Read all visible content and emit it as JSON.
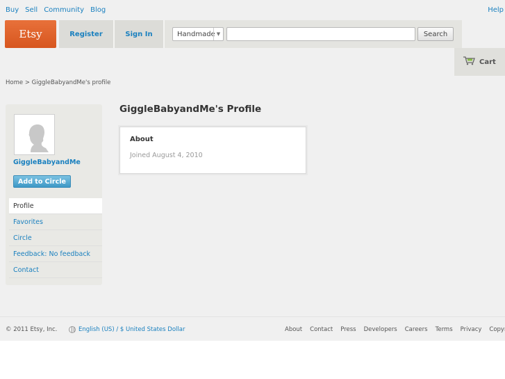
{
  "top_nav": {
    "items": [
      "Buy",
      "Sell",
      "Community",
      "Blog"
    ],
    "help": "Help"
  },
  "header": {
    "logo": "Etsy",
    "register": "Register",
    "sign_in": "Sign In",
    "category_selected": "Handmade",
    "search_value": "",
    "search_button": "Search",
    "cart": "Cart"
  },
  "breadcrumb": {
    "home": "Home",
    "separator": ">",
    "current": "GiggleBabyandMe's profile"
  },
  "sidebar": {
    "username": "GiggleBabyandMe",
    "add_button": "Add to Circle",
    "items": [
      {
        "label": "Profile",
        "active": true
      },
      {
        "label": "Favorites",
        "active": false
      },
      {
        "label": "Circle",
        "active": false
      },
      {
        "label": "Feedback: No feedback",
        "active": false
      },
      {
        "label": "Contact",
        "active": false
      }
    ]
  },
  "main": {
    "title": "GiggleBabyandMe's Profile",
    "about_title": "About",
    "joined": "Joined August 4, 2010"
  },
  "footer": {
    "copyright": "© 2011 Etsy, Inc.",
    "locale": "English (US) / $ United States Dollar",
    "links": [
      "About",
      "Contact",
      "Press",
      "Developers",
      "Careers",
      "Terms",
      "Privacy",
      "Copyright"
    ]
  },
  "colors": {
    "brand_orange": "#d7561f",
    "link_blue": "#1a80bf",
    "button_blue": "#3d98c6"
  }
}
